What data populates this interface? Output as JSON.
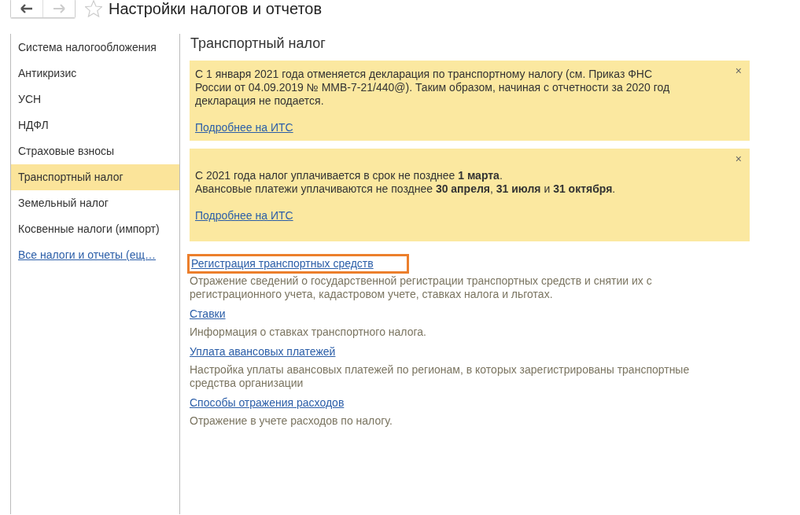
{
  "window": {
    "title": "Настройки налогов и отчетов",
    "favorite": false
  },
  "sidebar": {
    "items": [
      {
        "label": "Система налогообложения",
        "kind": "item",
        "selected": false
      },
      {
        "label": "Антикризис",
        "kind": "item",
        "selected": false
      },
      {
        "label": "УСН",
        "kind": "item",
        "selected": false
      },
      {
        "label": "НДФЛ",
        "kind": "item",
        "selected": false
      },
      {
        "label": "Страховые взносы",
        "kind": "item",
        "selected": false
      },
      {
        "label": "Транспортный налог",
        "kind": "item",
        "selected": true
      },
      {
        "label": "Земельный налог",
        "kind": "item",
        "selected": false
      },
      {
        "label": "Косвенные налоги (импорт)",
        "kind": "item",
        "selected": false
      },
      {
        "label": "Все налоги и отчеты (ещ…",
        "kind": "link",
        "selected": false
      }
    ]
  },
  "section_title": "Транспортный налог",
  "notices": [
    {
      "lines": [
        "С 1 января 2021 года отменяется декларация по транспортному налогу (см. Приказ ФНС России от 04.09.2019 № ММВ-7-21/440@). Таким образом, начиная с отчетности за 2020 год декларация не подается."
      ],
      "link": "Подробнее на ИТС",
      "close": "×"
    },
    {
      "lines": [
        "С 2021 года налог уплачивается в срок не позднее **1 марта**.",
        "Авансовые платежи уплачиваются не позднее **30 апреля**, **31 июля** и **31 октября**."
      ],
      "link": "Подробнее на ИТС",
      "close": "×"
    }
  ],
  "links": [
    {
      "label": "Регистрация транспортных средств",
      "description": "Отражение сведений о государственной регистрации транспортных средств и снятии их с регистрационного учета, кадастровом учете, ставках налога и льготах.",
      "highlighted": true
    },
    {
      "label": "Ставки",
      "description": "Информация о ставках транспортного налога.",
      "highlighted": false
    },
    {
      "label": "Уплата авансовых платежей",
      "description": "Настройка уплаты авансовых платежей по регионам, в которых зарегистрированы транспортные средства организации",
      "highlighted": false
    },
    {
      "label": "Способы отражения расходов",
      "description": "Отражение в учете расходов по налогу.",
      "highlighted": false
    }
  ]
}
